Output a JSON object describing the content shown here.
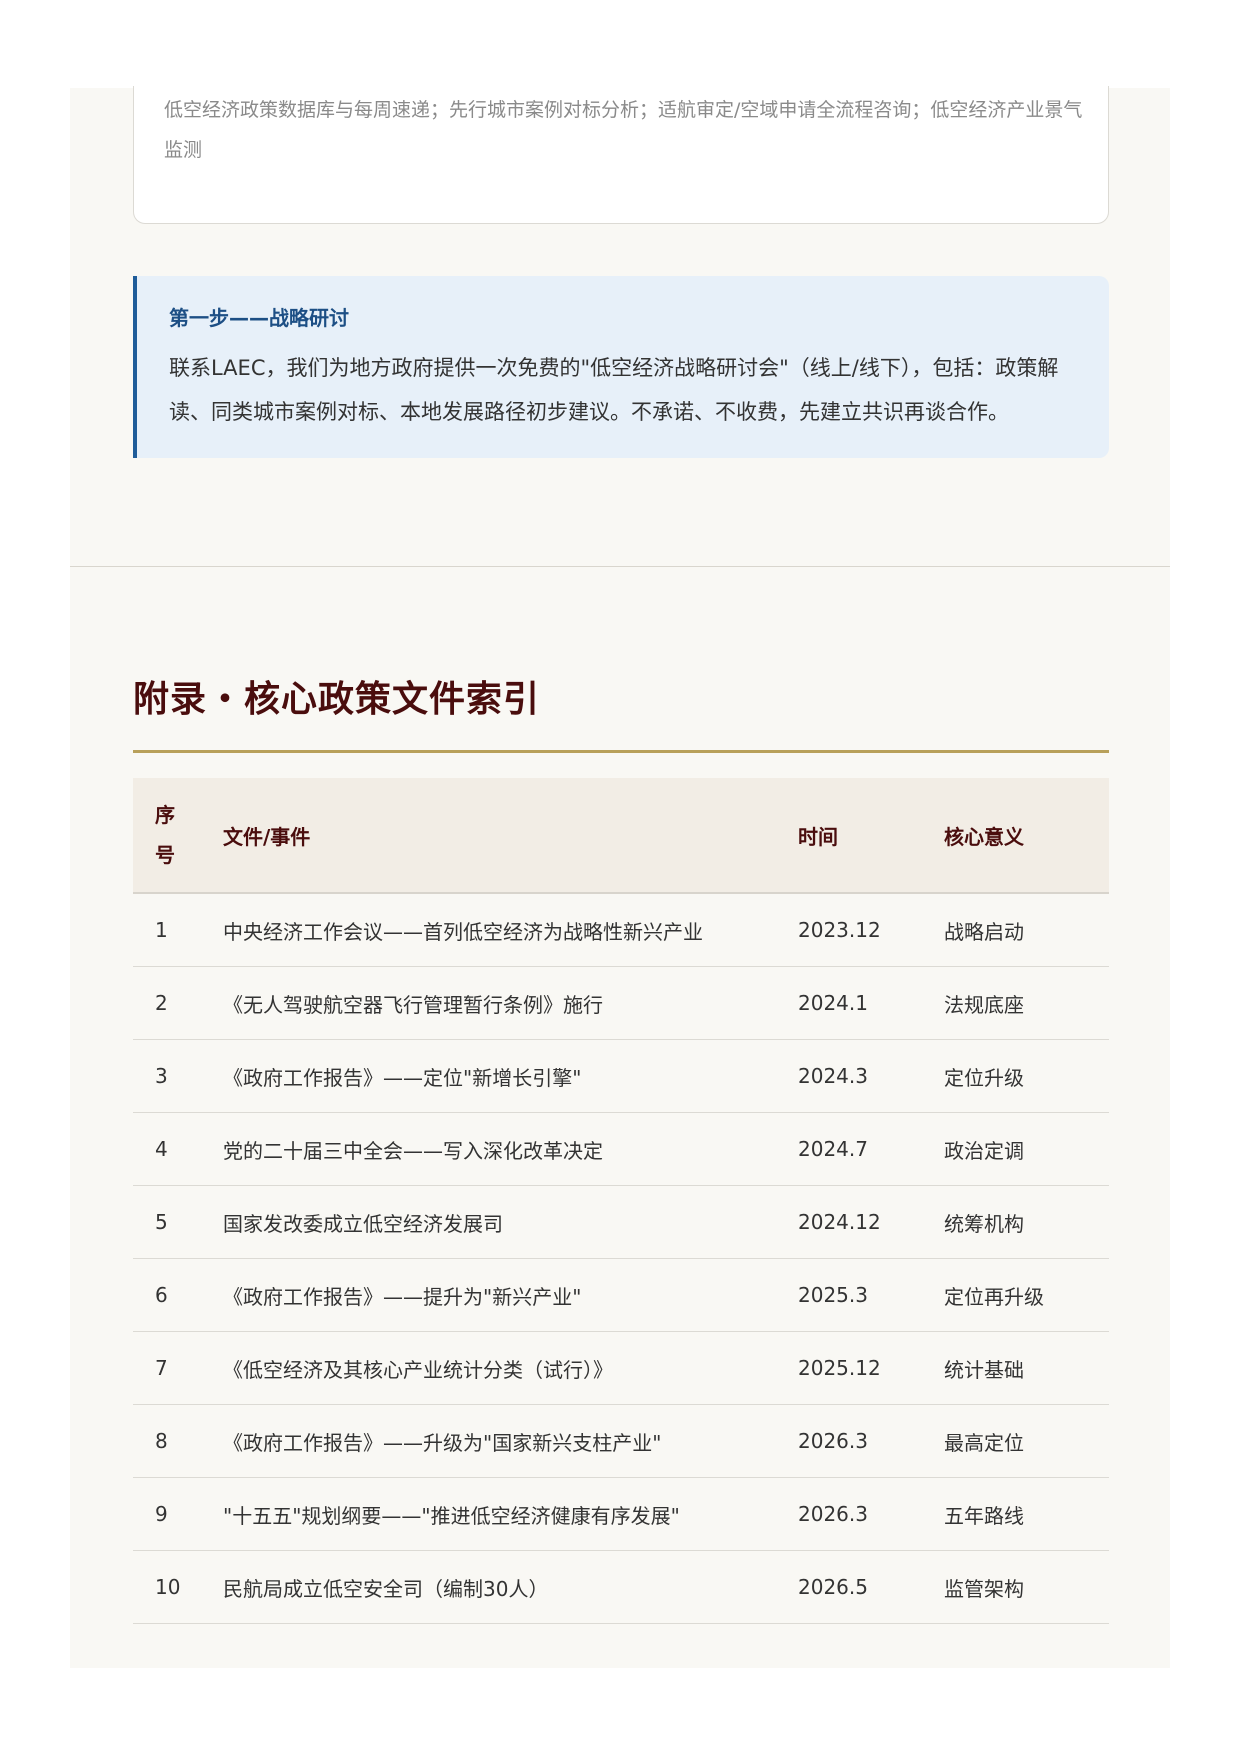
{
  "card": {
    "text": "低空经济政策数据库与每周速递；先行城市案例对标分析；适航审定/空域申请全流程咨询；低空经济产业景气监测"
  },
  "callout": {
    "title": "第一步——战略研讨",
    "body": "联系LAEC，我们为地方政府提供一次免费的\"低空经济战略研讨会\"（线上/线下），包括：政策解读、同类城市案例对标、本地发展路径初步建议。不承诺、不收费，先建立共识再谈合作。"
  },
  "appendix": {
    "title": "附录・核心政策文件索引",
    "headers": {
      "no": "序号",
      "doc": "文件/事件",
      "time": "时间",
      "meaning": "核心意义"
    },
    "rows": [
      {
        "no": "1",
        "doc": "中央经济工作会议——首列低空经济为战略性新兴产业",
        "time": "2023.12",
        "meaning": "战略启动"
      },
      {
        "no": "2",
        "doc": "《无人驾驶航空器飞行管理暂行条例》施行",
        "time": "2024.1",
        "meaning": "法规底座"
      },
      {
        "no": "3",
        "doc": "《政府工作报告》——定位\"新增长引擎\"",
        "time": "2024.3",
        "meaning": "定位升级"
      },
      {
        "no": "4",
        "doc": "党的二十届三中全会——写入深化改革决定",
        "time": "2024.7",
        "meaning": "政治定调"
      },
      {
        "no": "5",
        "doc": "国家发改委成立低空经济发展司",
        "time": "2024.12",
        "meaning": "统筹机构"
      },
      {
        "no": "6",
        "doc": "《政府工作报告》——提升为\"新兴产业\"",
        "time": "2025.3",
        "meaning": "定位再升级"
      },
      {
        "no": "7",
        "doc": "《低空经济及其核心产业统计分类（试行）》",
        "time": "2025.12",
        "meaning": "统计基础"
      },
      {
        "no": "8",
        "doc": "《政府工作报告》——升级为\"国家新兴支柱产业\"",
        "time": "2026.3",
        "meaning": "最高定位"
      },
      {
        "no": "9",
        "doc": "\"十五五\"规划纲要——\"推进低空经济健康有序发展\"",
        "time": "2026.3",
        "meaning": "五年路线"
      },
      {
        "no": "10",
        "doc": "民航局成立低空安全司（编制30人）",
        "time": "2026.5",
        "meaning": "监管架构"
      }
    ]
  }
}
